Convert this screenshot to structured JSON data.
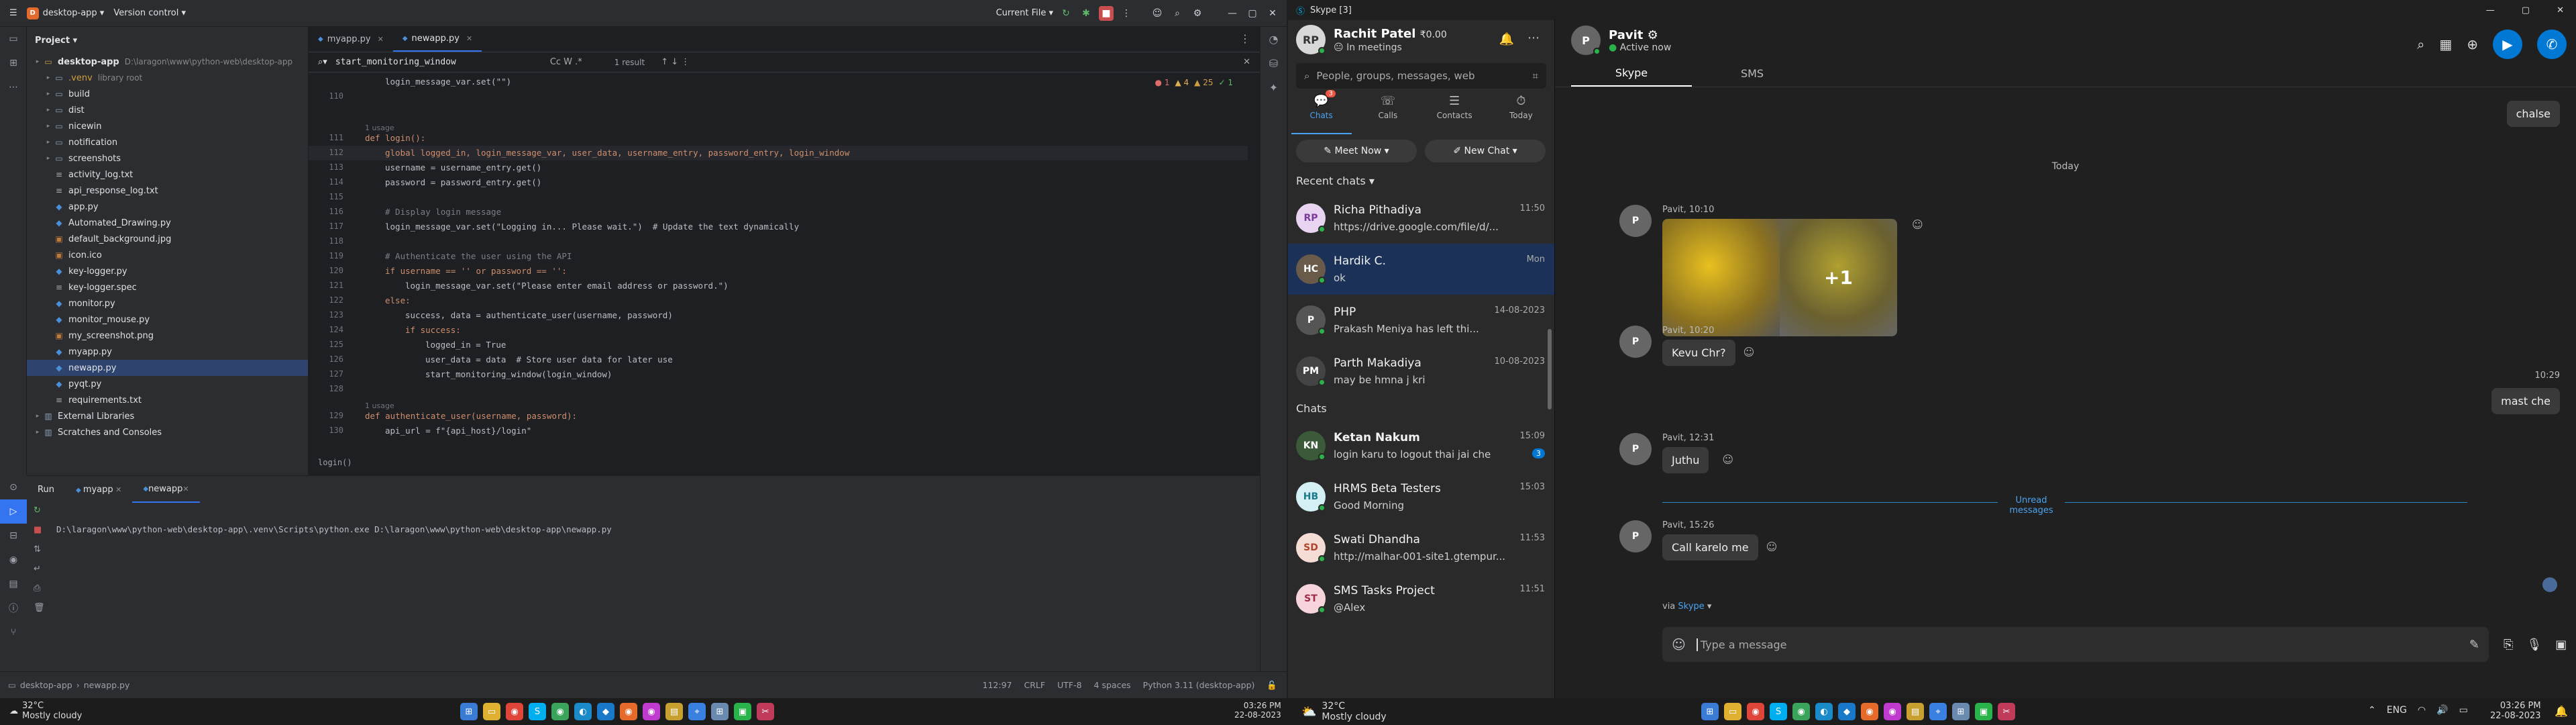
{
  "ide": {
    "project_name": "desktop-app",
    "vcs_label": "Version control",
    "run_config": "Current File",
    "panel_title": "Project",
    "tree": [
      {
        "label": "desktop-app",
        "extra": "D:\\laragon\\www\\python-web\\desktop-app",
        "type": "root"
      },
      {
        "label": ".venv",
        "extra": "library root",
        "type": "folder"
      },
      {
        "label": "build",
        "type": "folder"
      },
      {
        "label": "dist",
        "type": "folder"
      },
      {
        "label": "nicewin",
        "type": "folder"
      },
      {
        "label": "notification",
        "type": "folder"
      },
      {
        "label": "screenshots",
        "type": "folder"
      },
      {
        "label": "activity_log.txt",
        "type": "txt"
      },
      {
        "label": "api_response_log.txt",
        "type": "txt"
      },
      {
        "label": "app.py",
        "type": "py"
      },
      {
        "label": "Automated_Drawing.py",
        "type": "py"
      },
      {
        "label": "default_background.jpg",
        "type": "img"
      },
      {
        "label": "icon.ico",
        "type": "img"
      },
      {
        "label": "key-logger.py",
        "type": "py"
      },
      {
        "label": "key-logger.spec",
        "type": "txt"
      },
      {
        "label": "monitor.py",
        "type": "py"
      },
      {
        "label": "monitor_mouse.py",
        "type": "py"
      },
      {
        "label": "my_screenshot.png",
        "type": "img"
      },
      {
        "label": "myapp.py",
        "type": "py"
      },
      {
        "label": "newapp.py",
        "type": "py",
        "selected": true
      },
      {
        "label": "pyqt.py",
        "type": "py"
      },
      {
        "label": "requirements.txt",
        "type": "txt"
      },
      {
        "label": "External Libraries",
        "type": "lib"
      },
      {
        "label": "Scratches and Consoles",
        "type": "lib"
      }
    ],
    "tabs": [
      {
        "label": "myapp.py"
      },
      {
        "label": "newapp.py",
        "active": true
      }
    ],
    "find": {
      "query": "start_monitoring_window",
      "results": "1 result"
    },
    "inspections": {
      "errors": "1",
      "warnings": "4",
      "weak": "25",
      "typos": "1"
    },
    "code_lines": [
      {
        "n": "",
        "t": "login_message_var.set(\"\")",
        "ind": 1
      },
      {
        "n": "110",
        "t": "",
        "ind": 0
      },
      {
        "n": "",
        "t": "",
        "ind": 0
      },
      {
        "n": "",
        "usage": "1 usage"
      },
      {
        "n": "111",
        "t": "def login():",
        "ind": 0,
        "k": "def"
      },
      {
        "n": "112",
        "t": "global logged_in, login_message_var, user_data, username_entry, password_entry, login_window",
        "ind": 1,
        "hl": true
      },
      {
        "n": "113",
        "t": "username = username_entry.get()",
        "ind": 1
      },
      {
        "n": "114",
        "t": "password = password_entry.get()",
        "ind": 1
      },
      {
        "n": "115",
        "t": "",
        "ind": 0
      },
      {
        "n": "116",
        "t": "# Display login message",
        "ind": 1,
        "c": true
      },
      {
        "n": "117",
        "t": "login_message_var.set(\"Logging in... Please wait.\")  # Update the text dynamically",
        "ind": 1
      },
      {
        "n": "118",
        "t": "",
        "ind": 0
      },
      {
        "n": "119",
        "t": "# Authenticate the user using the API",
        "ind": 1,
        "c": true
      },
      {
        "n": "120",
        "t": "if username == '' or password == '':",
        "ind": 1
      },
      {
        "n": "121",
        "t": "login_message_var.set(\"Please enter email address or password.\")",
        "ind": 2
      },
      {
        "n": "122",
        "t": "else:",
        "ind": 1
      },
      {
        "n": "123",
        "t": "success, data = authenticate_user(username, password)",
        "ind": 2
      },
      {
        "n": "124",
        "t": "if success:",
        "ind": 2
      },
      {
        "n": "125",
        "t": "logged_in = True",
        "ind": 3
      },
      {
        "n": "126",
        "t": "user_data = data  # Store user data for later use",
        "ind": 3
      },
      {
        "n": "127",
        "t": "start_monitoring_window(login_window)",
        "ind": 3
      },
      {
        "n": "128",
        "t": "",
        "ind": 0
      },
      {
        "n": "",
        "usage": "1 usage"
      },
      {
        "n": "129",
        "t": "def authenticate_user(username, password):",
        "ind": 0
      },
      {
        "n": "130",
        "t": "api_url = f\"{api_host}/login\"",
        "ind": 1
      }
    ],
    "breadcrumb_fn": "login()",
    "run": {
      "title": "Run",
      "tabs": [
        "myapp",
        "newapp"
      ],
      "command": "D:\\laragon\\www\\python-web\\desktop-app\\.venv\\Scripts\\python.exe D:\\laragon\\www\\python-web\\desktop-app\\newapp.py"
    },
    "status": {
      "path1": "desktop-app",
      "path2": "newapp.py",
      "pos": "112:97",
      "eol": "CRLF",
      "enc": "UTF-8",
      "indent": "4 spaces",
      "interp": "Python 3.11 (desktop-app)"
    }
  },
  "skype": {
    "window_title": "Skype [3]",
    "me": {
      "name": "Rachit Patel",
      "credit": "₹0.00",
      "status": "In meetings"
    },
    "search_placeholder": "People, groups, messages, web",
    "nav": [
      {
        "label": "Chats",
        "badge": "3"
      },
      {
        "label": "Calls"
      },
      {
        "label": "Contacts"
      },
      {
        "label": "Today"
      }
    ],
    "meet_now": "Meet Now",
    "new_chat": "New Chat",
    "recent_label": "Recent chats",
    "chats_label": "Chats",
    "recent": [
      {
        "name": "Richa Pithadiya",
        "initials": "RP",
        "preview": "https://drive.google.com/file/d/...",
        "time": "11:50",
        "color": "#e8d3f0",
        "fg": "#7a3a9a"
      },
      {
        "name": "Hardik C.",
        "initials": "HC",
        "preview": "ok",
        "time": "Mon",
        "color": "#6a5a4a",
        "fg": "#fff",
        "selected": true
      },
      {
        "name": "PHP",
        "initials": "P",
        "preview": "Prakash Meniya has left thi...",
        "time": "14-08-2023",
        "color": "#555",
        "fg": "#fff"
      },
      {
        "name": "Parth Makadiya",
        "initials": "PM",
        "preview": "may be hmna j kri",
        "time": "10-08-2023",
        "color": "#444",
        "fg": "#fff"
      }
    ],
    "chats": [
      {
        "name": "Ketan Nakum",
        "initials": "KN",
        "preview": "login karu to logout thai jai che",
        "time": "15:09",
        "badge": "3",
        "bold": true,
        "color": "#3a5a3a",
        "fg": "#fff"
      },
      {
        "name": "HRMS Beta Testers",
        "initials": "HB",
        "preview": "Good Morning",
        "time": "15:03",
        "color": "#d4f0f5",
        "fg": "#1a7a8a"
      },
      {
        "name": "Swati Dhandha",
        "initials": "SD",
        "preview": "http://malhar-001-site1.gtempur...",
        "time": "11:53",
        "color": "#f5dcd4",
        "fg": "#b0452a"
      },
      {
        "name": "SMS Tasks Project",
        "initials": "ST",
        "preview": "@Alex",
        "time": "11:51",
        "color": "#f5d4dc",
        "fg": "#a02a4a"
      }
    ],
    "contact": {
      "name": "Pavit",
      "status": "Active now"
    },
    "main_tabs": [
      "Skype",
      "SMS"
    ],
    "day_label": "Today",
    "messages": [
      {
        "side": "right",
        "text": "chalse"
      },
      {
        "side": "left",
        "sender": "Pavit, 10:10",
        "image": true,
        "more": "+1"
      },
      {
        "side": "left",
        "sender": "Pavit, 10:20",
        "text": "Kevu Chr?"
      },
      {
        "side": "right",
        "time": "10:29",
        "text": "mast che"
      },
      {
        "side": "left",
        "sender": "Pavit, 12:31",
        "text": "Juthu"
      },
      {
        "side": "left",
        "sender": "Pavit, 15:26",
        "text": "Call karelo me"
      }
    ],
    "unread_label": "Unread messages",
    "via": "via",
    "via_link": "Skype",
    "compose_placeholder": "Type a message"
  },
  "taskbar": {
    "weather_temp": "32°C",
    "weather_desc": "Mostly cloudy",
    "time_left": "03:26 PM",
    "date_left": "22-08-2023",
    "lang": "ENG",
    "time_right": "03:26 PM",
    "date_right": "22-08-2023"
  }
}
